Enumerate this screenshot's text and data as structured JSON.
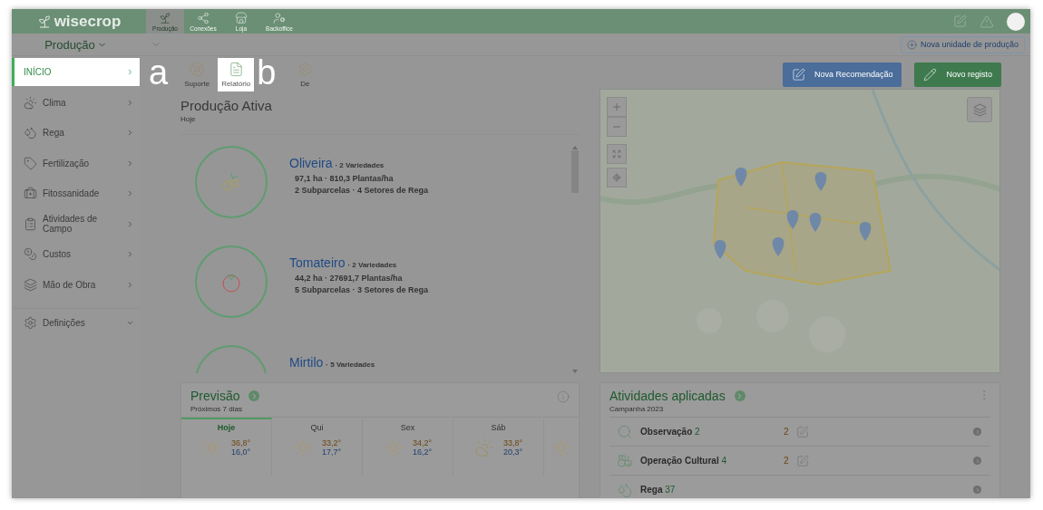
{
  "top_bar": {
    "logo": "wisecrop",
    "tabs": [
      {
        "label": "Produção",
        "selected": true
      },
      {
        "label": "Conexões",
        "selected": false
      },
      {
        "label": "Loja",
        "selected": false
      },
      {
        "label": "Backoffice",
        "selected": false
      }
    ]
  },
  "subbar": {
    "section": "Produção",
    "new_unit_button": "Nova unidade de produção"
  },
  "sidebar": {
    "items": [
      {
        "label": "INÍCIO",
        "kind": "page",
        "selected": true
      },
      {
        "label": "Clima",
        "kind": "page",
        "selected": false
      },
      {
        "label": "Rega",
        "kind": "page",
        "selected": false
      },
      {
        "label": "Fertilização",
        "kind": "page",
        "selected": false
      },
      {
        "label": "Fitossanidade",
        "kind": "page",
        "selected": false
      },
      {
        "label": "Atividades de Campo",
        "kind": "page",
        "selected": false
      },
      {
        "label": "Custos",
        "kind": "page",
        "selected": false
      },
      {
        "label": "Mão de Obra",
        "kind": "page",
        "selected": false
      },
      {
        "label": "Definições",
        "kind": "group",
        "selected": false
      }
    ]
  },
  "annotations": [
    "a",
    "b"
  ],
  "toolbar": {
    "items": [
      {
        "label": "Suporte",
        "selected": false
      },
      {
        "label": "Relatório",
        "selected": true
      },
      {
        "label": "De",
        "selected": false
      }
    ],
    "buttons": [
      {
        "label": "Nova Recomendação",
        "kind": "recommendation"
      },
      {
        "label": "Novo registo",
        "kind": "record"
      }
    ]
  },
  "active_production": {
    "title": "Produção Ativa",
    "subtitle": "Hoje",
    "crops": [
      {
        "name": "Oliveira",
        "varieties": "· 2 Variedades",
        "area": "97,1 ha · 810,3 Plantas/ha",
        "units": "2 Subparcelas · 4 Setores de Rega"
      },
      {
        "name": "Tomateiro",
        "varieties": "· 2 Variedades",
        "area": "44,2 ha · 27691,7 Plantas/ha",
        "units": "5 Subparcelas · 3 Setores de Rega"
      },
      {
        "name": "Mirtilo",
        "varieties": "· 5 Variedades"
      }
    ]
  },
  "forecast": {
    "title": "Previsão",
    "subtitle": "Próximos 7 dias",
    "days": [
      {
        "label": "Hoje",
        "selected": true,
        "kind": "sunny",
        "max": "36,8°",
        "min": "16,0°"
      },
      {
        "label": "Qui",
        "selected": false,
        "kind": "sunny",
        "max": "33,2°",
        "min": "17,7°"
      },
      {
        "label": "Sex",
        "selected": false,
        "kind": "sunny",
        "max": "34,2°",
        "min": "16,2°"
      },
      {
        "label": "Sáb",
        "selected": false,
        "kind": "cloudy",
        "max": "33,8°",
        "min": "20,3°"
      },
      {
        "selected": false,
        "kind": "sunny"
      }
    ]
  },
  "activities": {
    "title": "Atividades aplicadas",
    "subtitle": "Campanha 2023",
    "rows": [
      {
        "name": "Observação",
        "count": "2",
        "pending": "2"
      },
      {
        "name": "Operação Cultural",
        "count": "4",
        "pending": "2"
      },
      {
        "name": "Rega",
        "count": "37"
      }
    ]
  }
}
